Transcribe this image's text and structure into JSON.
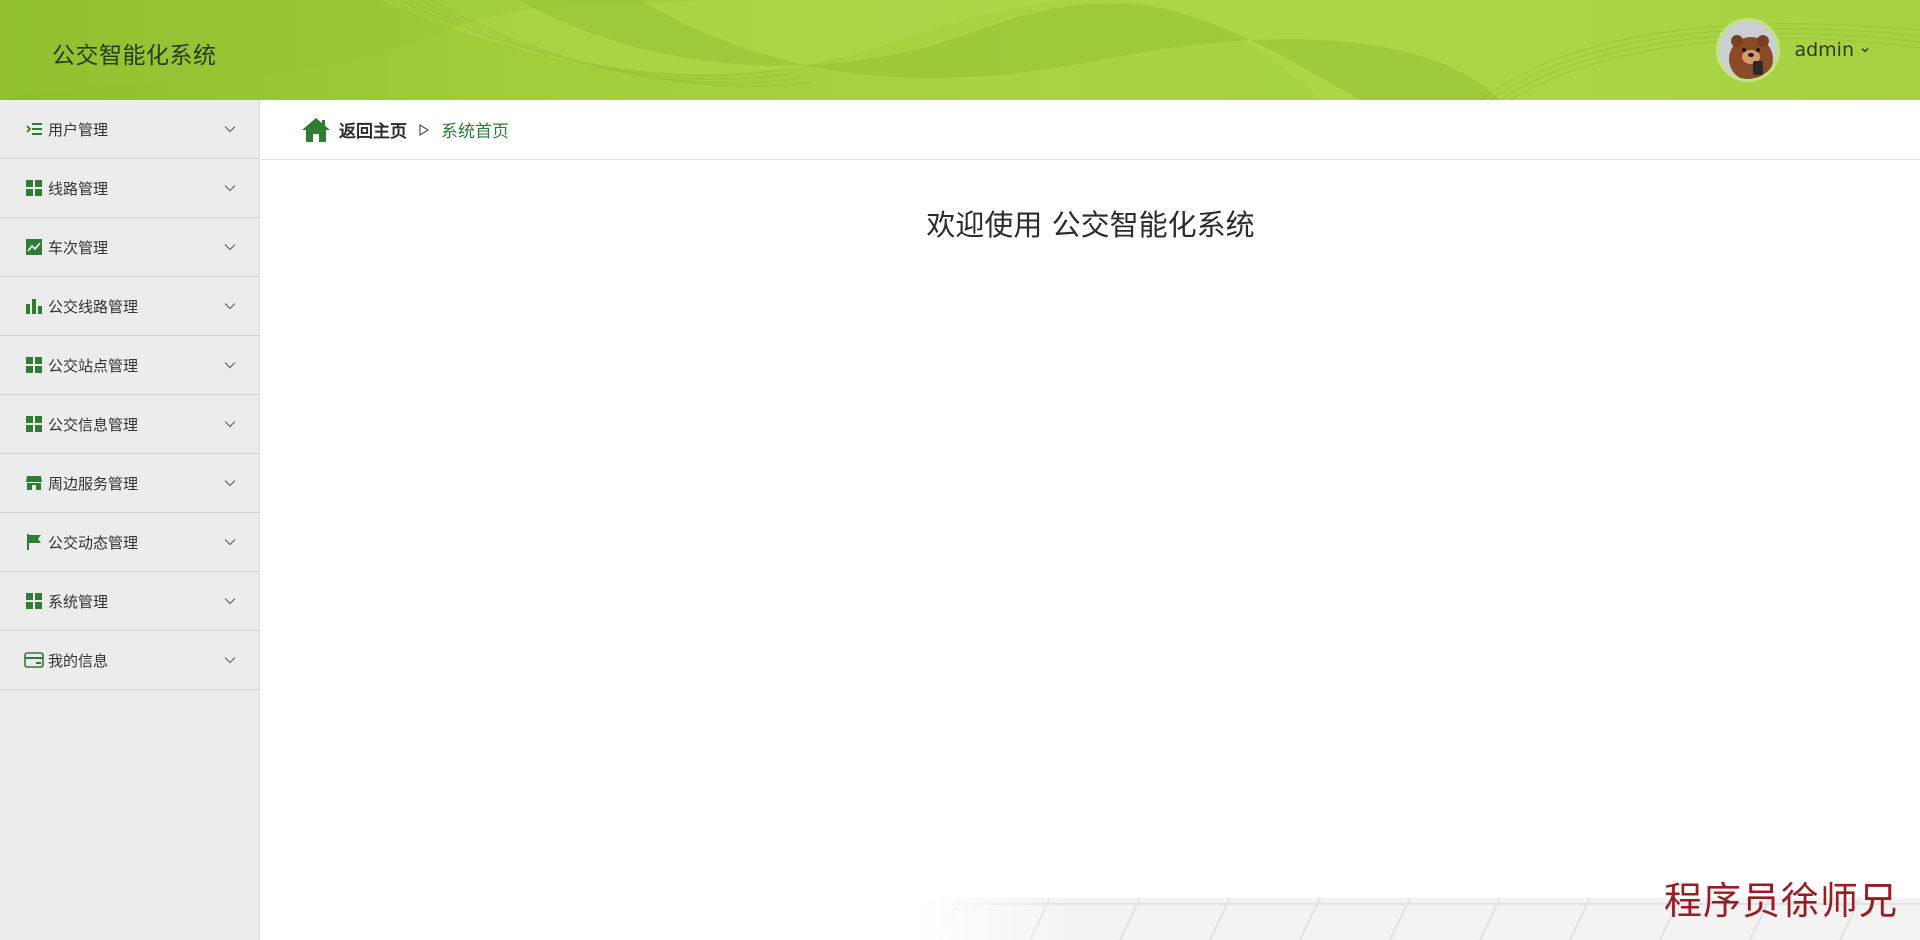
{
  "header": {
    "title": "公交智能化系统",
    "user": {
      "name": "admin",
      "avatar_icon": "bear-avatar-icon",
      "menu_icon": "chevron-down-icon"
    }
  },
  "sidebar": {
    "items": [
      {
        "label": "用户管理",
        "icon": "list-indent-icon"
      },
      {
        "label": "线路管理",
        "icon": "grid-icon"
      },
      {
        "label": "车次管理",
        "icon": "line-chart-icon"
      },
      {
        "label": "公交线路管理",
        "icon": "bar-chart-icon"
      },
      {
        "label": "公交站点管理",
        "icon": "grid-icon"
      },
      {
        "label": "公交信息管理",
        "icon": "grid-icon"
      },
      {
        "label": "周边服务管理",
        "icon": "shop-icon"
      },
      {
        "label": "公交动态管理",
        "icon": "flag-icon"
      },
      {
        "label": "系统管理",
        "icon": "grid-icon"
      },
      {
        "label": "我的信息",
        "icon": "card-icon"
      }
    ]
  },
  "breadcrumb": {
    "home": "返回主页",
    "current": "系统首页"
  },
  "main": {
    "welcome": "欢迎使用 公交智能化系统"
  },
  "watermark": "程序员徐师兄",
  "colors": {
    "header": "#a3d23f",
    "accent": "#2d7a3a",
    "sidebar_bg": "#ececec",
    "watermark": "#9b1b22"
  }
}
